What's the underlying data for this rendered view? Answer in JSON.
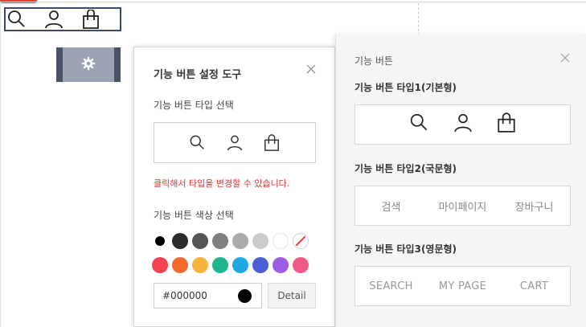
{
  "editor": {
    "preview_icons": [
      "search-icon",
      "user-icon",
      "shopping-bag-icon"
    ]
  },
  "gear_tool": {
    "icon": "gear-icon"
  },
  "settings_panel": {
    "title": "기능 버튼 설정 도구",
    "type_select_label": "기능 버튼 타입 선택",
    "type_icons": [
      "search-icon",
      "user-icon",
      "shopping-bag-icon"
    ],
    "hint": "클릭해서 타입을 변경할 수 있습니다.",
    "color_select_label": "기능 버튼 색상 선택",
    "swatches_row1": [
      "#000000",
      "#2b2b2b",
      "#555555",
      "#808080",
      "#aaaaaa",
      "#cccccc",
      "#ffffff",
      "none"
    ],
    "swatches_row2": [
      "#f2434e",
      "#f26a2e",
      "#f5b43a",
      "#1fb58f",
      "#1fa8e0",
      "#4a5ed6",
      "#9b5de5",
      "#f05a89"
    ],
    "hex_value": "#000000",
    "detail_label": "Detail"
  },
  "type_panel": {
    "title": "기능 버튼",
    "type1_label": "기능 버튼 타입1(기본형)",
    "type1_icons": [
      "search-icon",
      "user-icon",
      "shopping-bag-icon"
    ],
    "type2_label": "기능 버튼 타입2(국문형)",
    "type2_items": [
      "검색",
      "마이페이지",
      "장바구니"
    ],
    "type3_label": "기능 버튼 타입3(영문형)",
    "type3_items": [
      "SEARCH",
      "MY PAGE",
      "CART"
    ]
  },
  "colors": {
    "accent_red": "#e03131",
    "selection_border": "#3c4a6e"
  }
}
